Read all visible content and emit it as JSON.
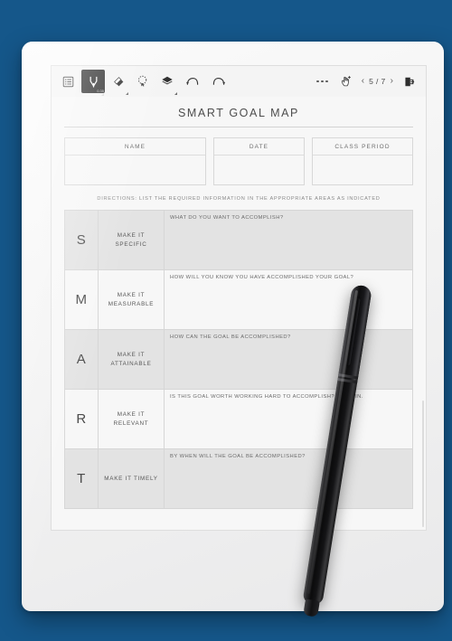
{
  "theme": {
    "background_color": "#15578a",
    "device_body_color": "#f3f3f3",
    "screen_color": "#f7f7f7",
    "row_shade_color": "#e3e3e3",
    "active_tool_color": "#2d2d2d"
  },
  "toolbar": {
    "left_tools": [
      {
        "name": "document-list-icon",
        "label": "Document outline",
        "active": false
      },
      {
        "name": "pen-icon",
        "label": "Pen",
        "active": true,
        "size_label": "0.35"
      },
      {
        "name": "eraser-icon",
        "label": "Eraser",
        "active": false
      },
      {
        "name": "lasso-select-icon",
        "label": "Lasso select",
        "active": false
      },
      {
        "name": "layers-icon",
        "label": "Layers",
        "active": false
      },
      {
        "name": "undo-icon",
        "label": "Undo",
        "active": false
      },
      {
        "name": "redo-icon",
        "label": "Redo",
        "active": false
      }
    ],
    "more_options_label": "More options",
    "touch_tool_label": "Touch gesture",
    "prev_page_label": "‹",
    "next_page_label": "›",
    "page_indicator": "5 / 7",
    "current_page": 5,
    "total_pages": 7,
    "exit_label": "Exit"
  },
  "worksheet": {
    "title": "SMART GOAL MAP",
    "fields": [
      {
        "key": "name",
        "label": "NAME",
        "value": "",
        "placeholder": ""
      },
      {
        "key": "date",
        "label": "DATE",
        "value": "",
        "placeholder": ""
      },
      {
        "key": "class",
        "label": "CLASS PERIOD",
        "value": "",
        "placeholder": ""
      }
    ],
    "directions": "DIRECTIONS: LIST THE REQUIRED INFORMATION IN THE APPROPRIATE AREAS AS INDICATED",
    "rows": [
      {
        "letter": "S",
        "phrase": "MAKE IT SPECIFIC",
        "prompt": "WHAT DO YOU WANT TO ACCOMPLISH?",
        "answer": "",
        "shaded": true
      },
      {
        "letter": "M",
        "phrase": "MAKE IT\nMEASURABLE",
        "prompt": "HOW WILL YOU KNOW YOU HAVE ACCOMPLISHED YOUR GOAL?",
        "answer": "",
        "shaded": false
      },
      {
        "letter": "A",
        "phrase": "MAKE IT ATTAINABLE",
        "prompt": "HOW CAN THE GOAL BE ACCOMPLISHED?",
        "answer": "",
        "shaded": true
      },
      {
        "letter": "R",
        "phrase": "MAKE IT RELEVANT",
        "prompt": "IS THIS GOAL WORTH WORKING HARD TO ACCOMPLISH? EXPLAIN.",
        "answer": "",
        "shaded": false
      },
      {
        "letter": "T",
        "phrase": "MAKE IT TIMELY",
        "prompt": "BY WHEN WILL THE GOAL BE ACCOMPLISHED?",
        "answer": "",
        "shaded": true
      }
    ]
  },
  "accessories": {
    "stylus_name": "stylus-pen"
  }
}
